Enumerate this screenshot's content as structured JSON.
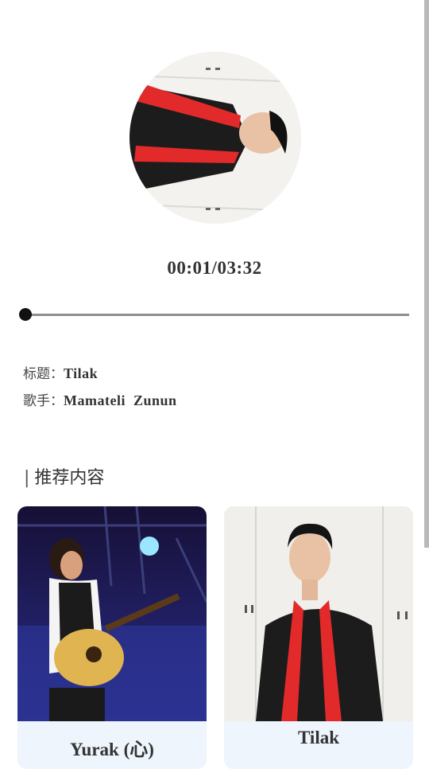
{
  "player": {
    "time_display": "00:01/03:32",
    "progress_fraction": 0.0047
  },
  "info": {
    "title_label": "标题：",
    "title_value": "Tilak",
    "artist_label": "歌手：",
    "artist_value": "Mamateli  Zunun"
  },
  "recommend": {
    "section_bar": "|",
    "section_title": "推荐内容",
    "items": [
      {
        "title": "Yurak (心)"
      },
      {
        "title": "Tilak"
      }
    ]
  }
}
